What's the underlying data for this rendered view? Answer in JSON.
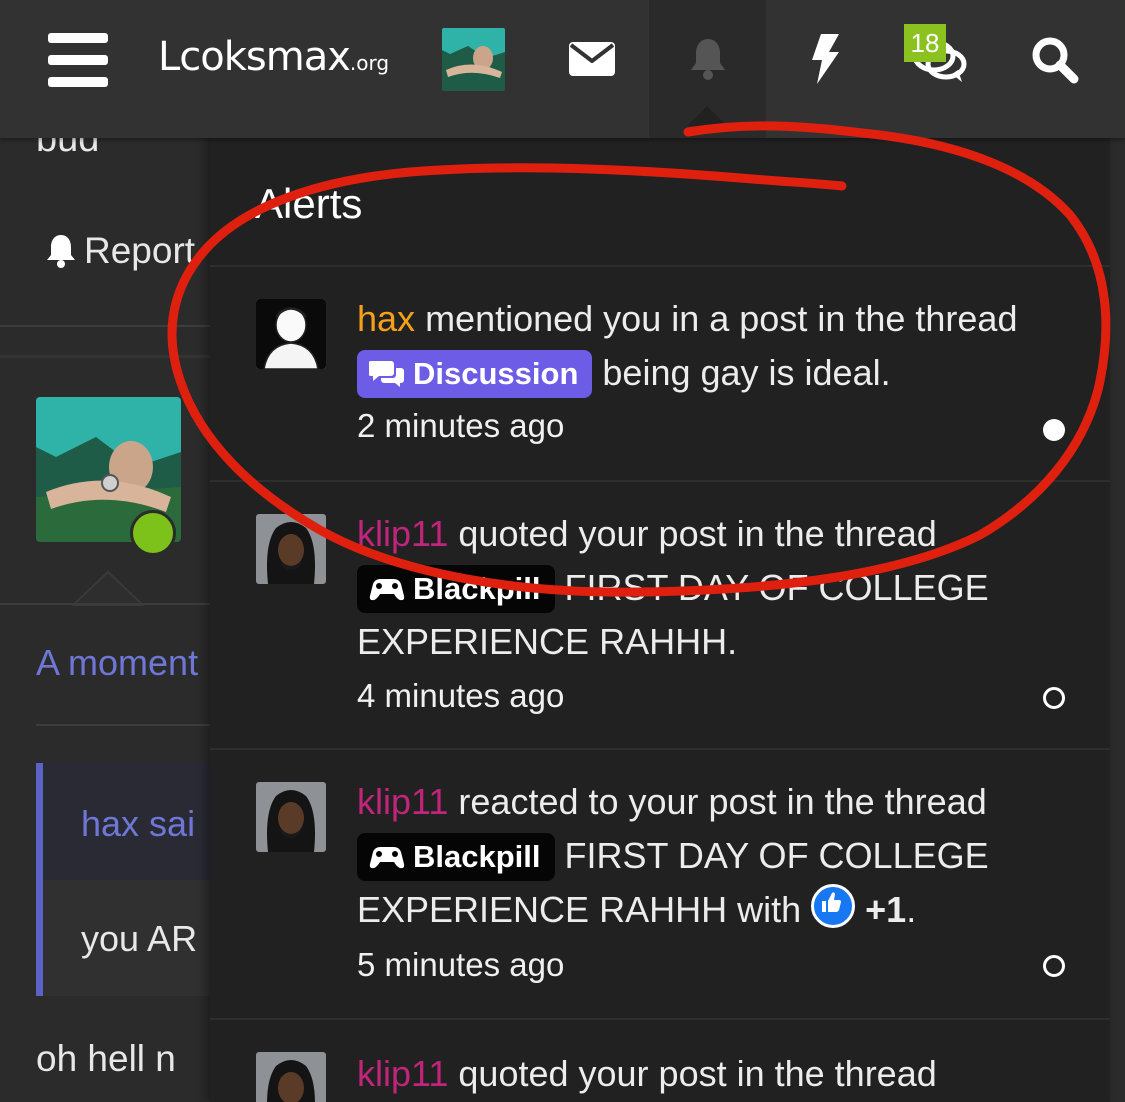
{
  "header": {
    "logo_main": "Lcoksmax",
    "logo_suffix": ".org",
    "conversations_badge": "18",
    "icons": [
      "menu-icon",
      "envelope-icon",
      "bell-icon",
      "bolt-icon",
      "chat-icon",
      "search-icon"
    ]
  },
  "background_page": {
    "partial_word": "bud",
    "report_label": "Report",
    "moment_link": "A moment",
    "quote_author": "hax sai",
    "quote_text": "you AR",
    "post_text": "oh hell n"
  },
  "alerts_panel": {
    "title": "Alerts",
    "items": [
      {
        "user": "hax",
        "action": "mentioned you in a post in the thread",
        "prefix": "Discussion",
        "thread": "being gay is ideal.",
        "time": "2 minutes ago",
        "read": false
      },
      {
        "user": "klip11",
        "action": "quoted your post in the thread",
        "prefix": "Blackpill",
        "thread": "FIRST DAY OF COLLEGE EXPERIENCE RAHHH.",
        "time": "4 minutes ago",
        "read": true
      },
      {
        "user": "klip11",
        "action": "reacted to your post in the thread",
        "prefix": "Blackpill",
        "thread": "FIRST DAY OF COLLEGE EXPERIENCE RAHHH",
        "reaction_word": "with",
        "reaction": "+1",
        "time": "5 minutes ago",
        "read": true
      },
      {
        "user": "klip11",
        "action": "quoted your post in the thread"
      }
    ]
  },
  "colors": {
    "annotation": "#e0200f",
    "discussion_prefix": "#6d5ce6",
    "online": "#7cc21a",
    "username_orange": "#f5a019",
    "username_pink": "#c0257b"
  }
}
